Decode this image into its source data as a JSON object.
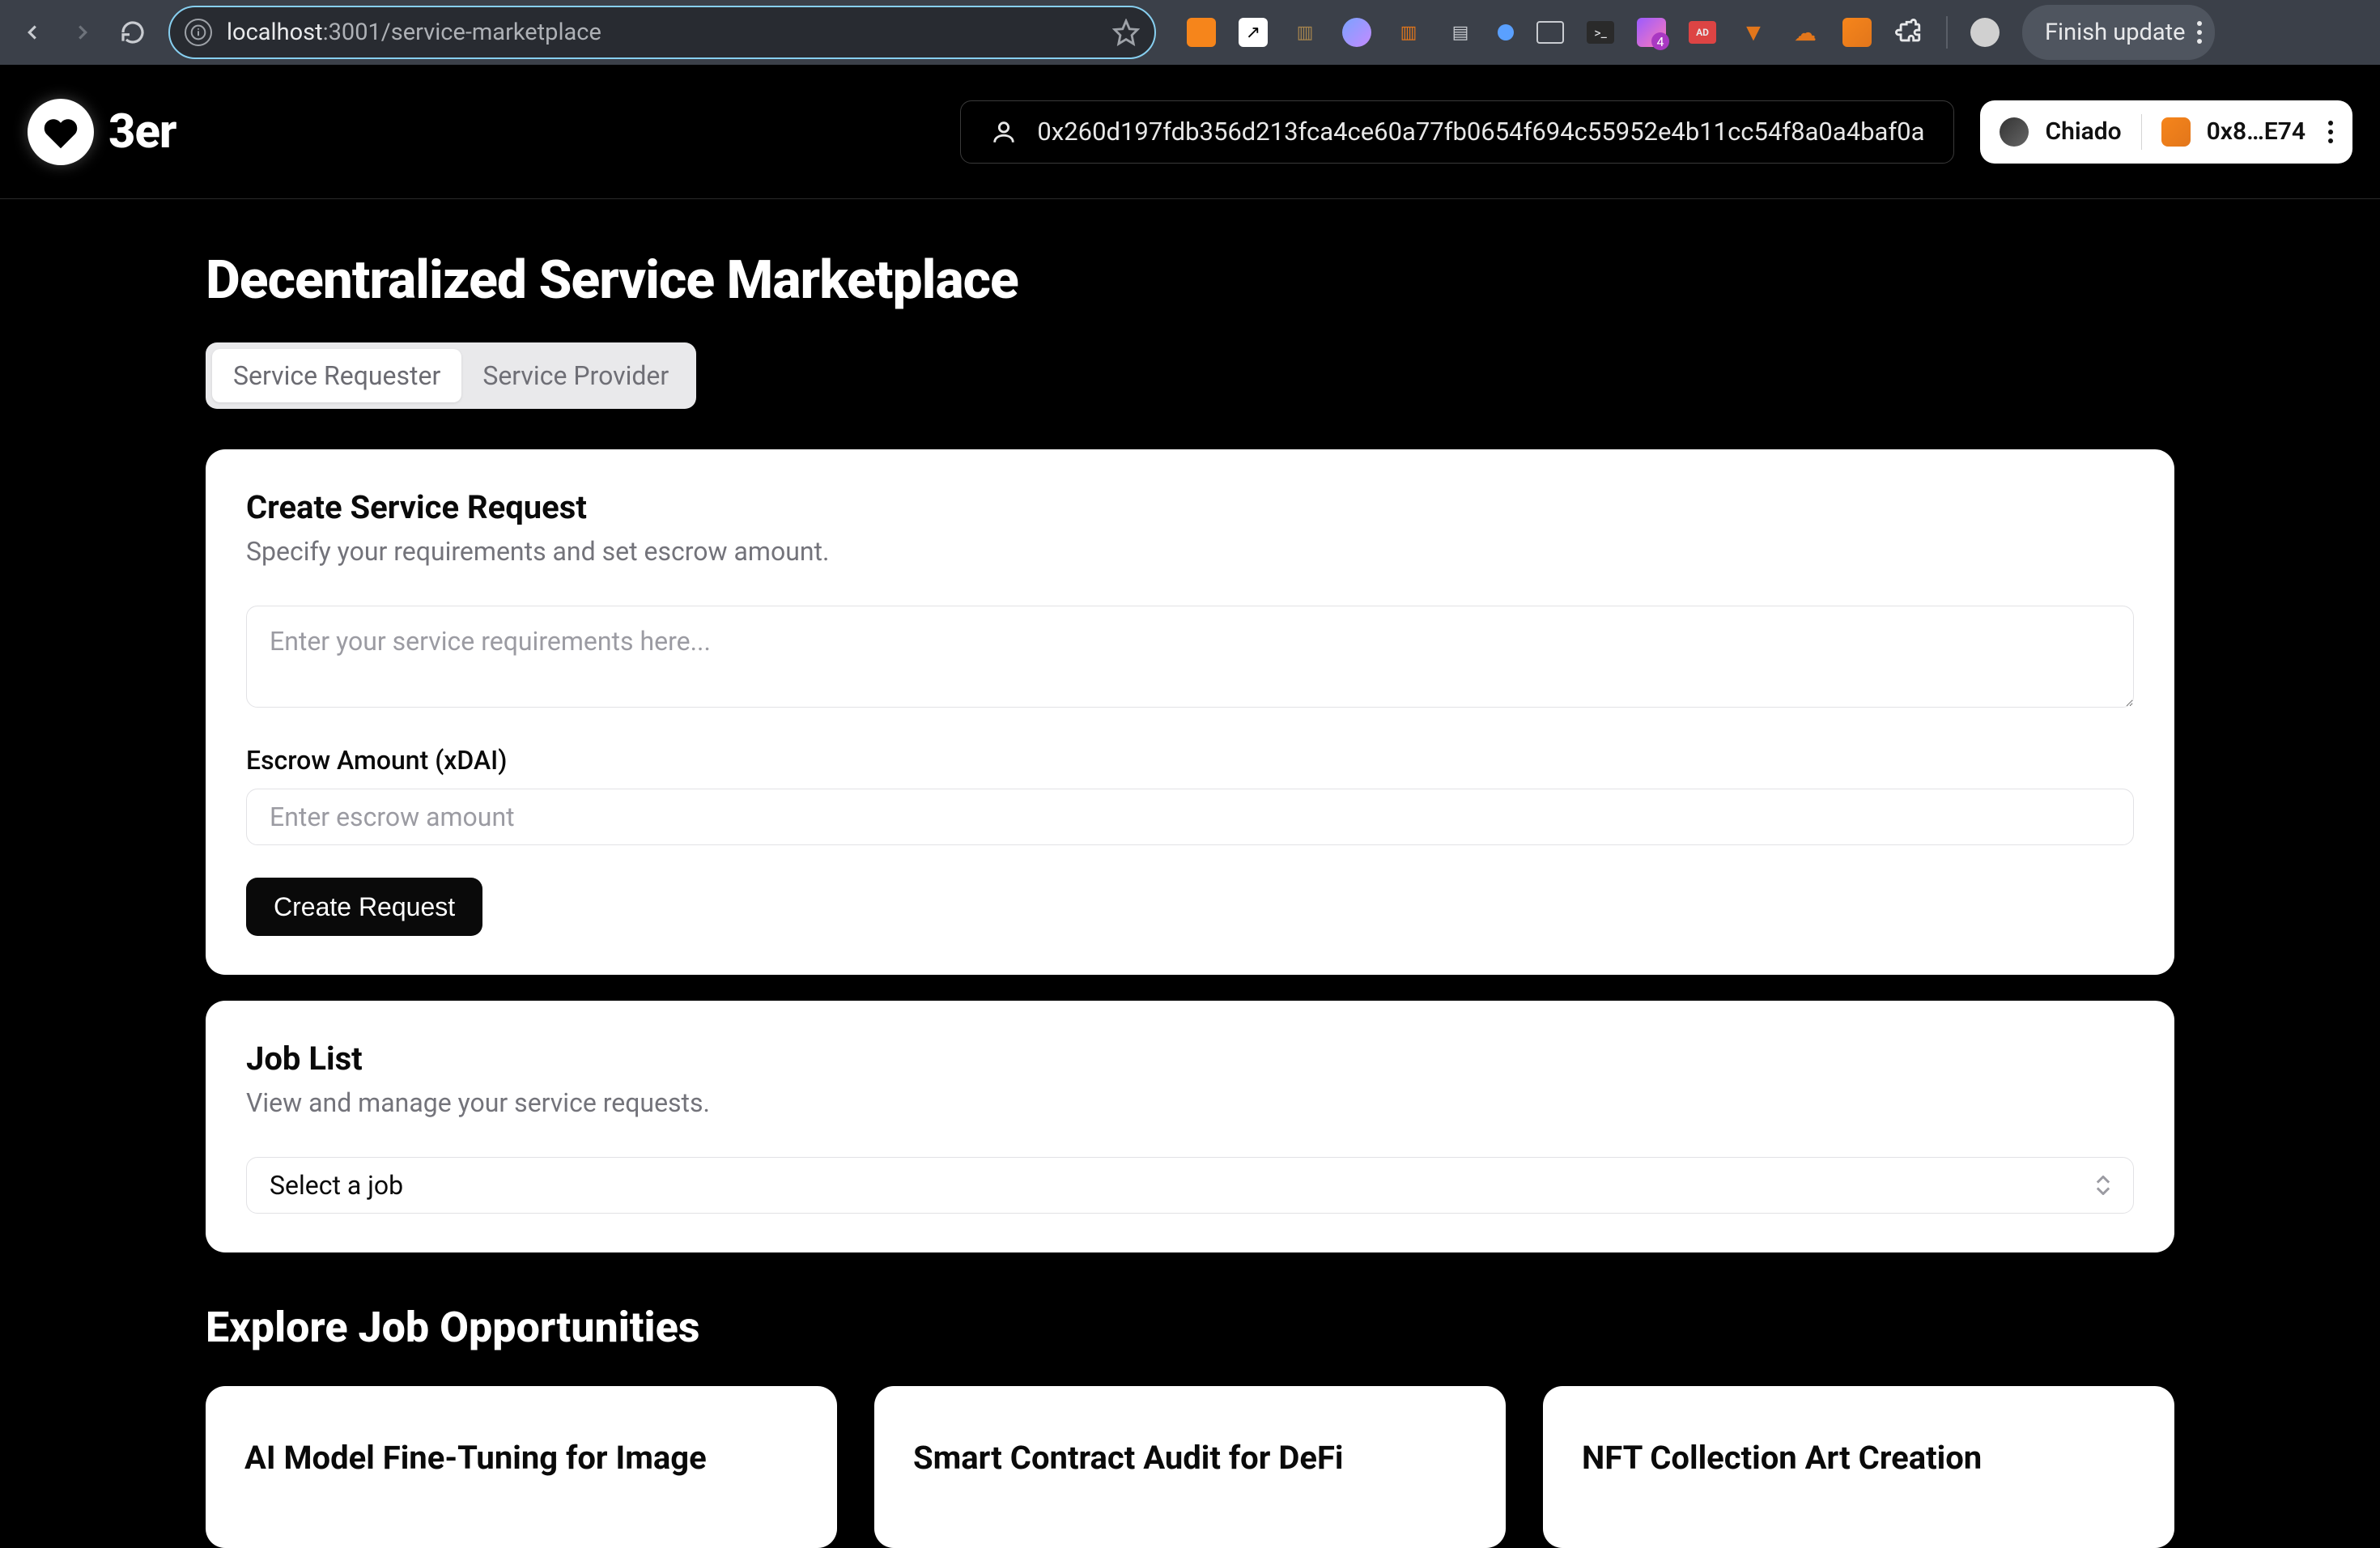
{
  "browser": {
    "url_host": "localhost",
    "url_port_path": ":3001/service-marketplace",
    "finish_label": "Finish update",
    "ext_badge": "4"
  },
  "header": {
    "brand": "3er",
    "address": "0x260d197fdb356d213fca4ce60a77fb0654f694c55952e4b11cc54f8a0a4baf0a",
    "chain": "Chiado",
    "wallet_short": "0x8…E74"
  },
  "page": {
    "title": "Decentralized Service Marketplace",
    "tabs": {
      "requester": "Service Requester",
      "provider": "Service Provider"
    },
    "create": {
      "title": "Create Service Request",
      "sub": "Specify your requirements and set escrow amount.",
      "req_placeholder": "Enter your service requirements here...",
      "escrow_label": "Escrow Amount (xDAI)",
      "escrow_placeholder": "Enter escrow amount",
      "button": "Create Request"
    },
    "jobs": {
      "title": "Job List",
      "sub": "View and manage your service requests.",
      "select_placeholder": "Select a job"
    },
    "explore": {
      "title": "Explore Job Opportunities",
      "cards": [
        {
          "title": "AI Model Fine-Tuning for Image"
        },
        {
          "title": "Smart Contract Audit for DeFi"
        },
        {
          "title": "NFT Collection Art Creation"
        }
      ]
    }
  }
}
